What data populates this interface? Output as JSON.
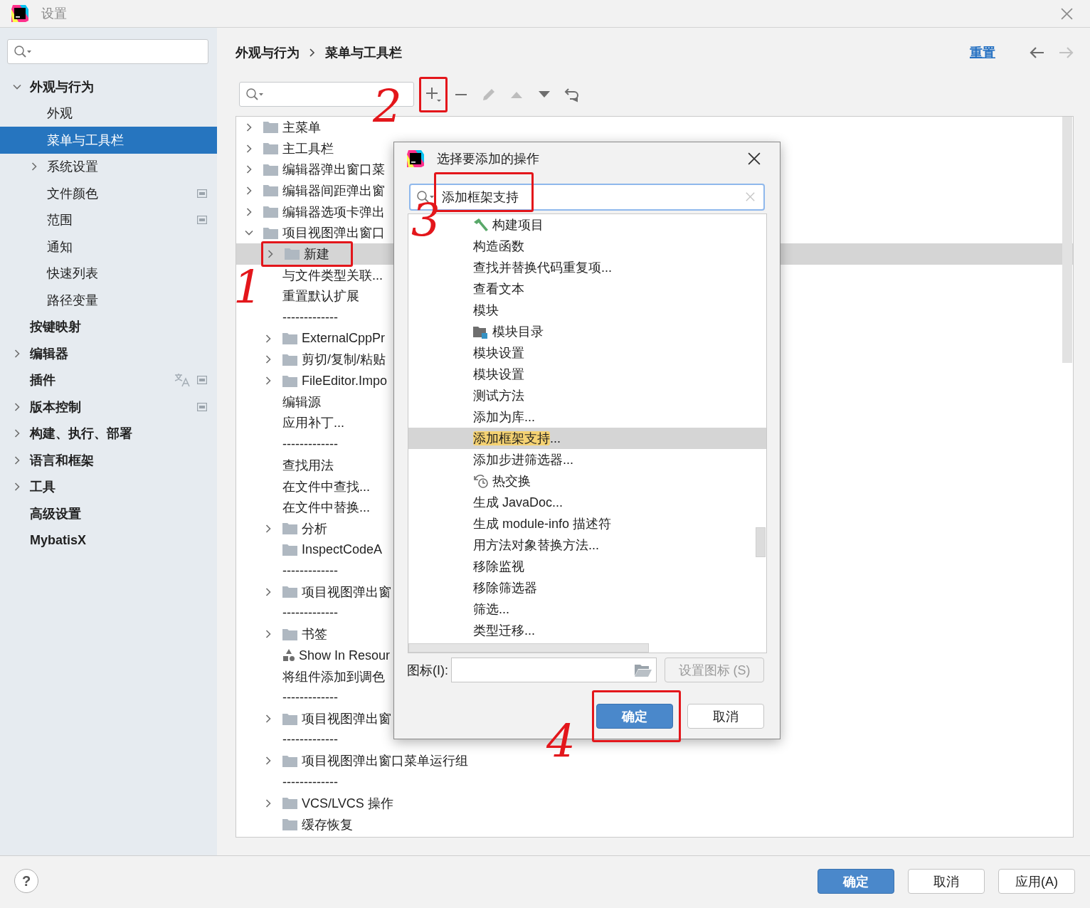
{
  "window": {
    "title": "设置"
  },
  "sidebar": {
    "items": [
      {
        "label": "外观与行为",
        "expanded": true,
        "selected": false,
        "project_scope": false,
        "translatable": false,
        "children": [
          {
            "label": "外观",
            "selected": false,
            "project_scope": false,
            "translatable": false
          },
          {
            "label": "菜单与工具栏",
            "selected": true,
            "project_scope": false,
            "translatable": false
          },
          {
            "label": "系统设置",
            "expanded": false,
            "selected": false,
            "project_scope": false,
            "translatable": false
          },
          {
            "label": "文件颜色",
            "selected": false,
            "project_scope": true,
            "translatable": false
          },
          {
            "label": "范围",
            "selected": false,
            "project_scope": true,
            "translatable": false
          },
          {
            "label": "通知",
            "selected": false,
            "project_scope": false,
            "translatable": false
          },
          {
            "label": "快速列表",
            "selected": false,
            "project_scope": false,
            "translatable": false
          },
          {
            "label": "路径变量",
            "selected": false,
            "project_scope": false,
            "translatable": false
          }
        ]
      },
      {
        "label": "按键映射",
        "selected": false,
        "project_scope": false,
        "translatable": false
      },
      {
        "label": "编辑器",
        "expanded": false,
        "selected": false,
        "project_scope": false,
        "translatable": false
      },
      {
        "label": "插件",
        "selected": false,
        "project_scope": true,
        "translatable": true
      },
      {
        "label": "版本控制",
        "expanded": false,
        "selected": false,
        "project_scope": true,
        "translatable": false
      },
      {
        "label": "构建、执行、部署",
        "expanded": false,
        "selected": false,
        "project_scope": false,
        "translatable": false
      },
      {
        "label": "语言和框架",
        "expanded": false,
        "selected": false,
        "project_scope": false,
        "translatable": false
      },
      {
        "label": "工具",
        "expanded": false,
        "selected": false,
        "project_scope": false,
        "translatable": false
      },
      {
        "label": "高级设置",
        "selected": false,
        "project_scope": false,
        "translatable": false
      },
      {
        "label": "MybatisX",
        "selected": false,
        "project_scope": false,
        "translatable": false
      }
    ]
  },
  "breadcrumb": [
    "外观与行为",
    "菜单与工具栏"
  ],
  "reset_link": "重置",
  "nav": [
    {
      "kind": "back",
      "disabled": false
    },
    {
      "kind": "forward",
      "disabled": true
    }
  ],
  "toolbar": {
    "buttons": [
      {
        "kind": "add",
        "disabled": false,
        "annotated": true
      },
      {
        "kind": "remove",
        "disabled": false,
        "annotated": false
      },
      {
        "kind": "edit",
        "disabled": true,
        "annotated": false
      },
      {
        "kind": "move-up",
        "disabled": true,
        "annotated": false
      },
      {
        "kind": "move-down",
        "disabled": false,
        "annotated": false
      },
      {
        "kind": "restore",
        "disabled": false,
        "annotated": false
      }
    ]
  },
  "action_tree": {
    "items": [
      {
        "kind": "folder",
        "label": "主菜单",
        "expanded": false,
        "selected": false,
        "annotated": false
      },
      {
        "kind": "folder",
        "label": "主工具栏",
        "expanded": false,
        "selected": false,
        "annotated": false
      },
      {
        "kind": "folder",
        "label": "编辑器弹出窗口菜",
        "expanded": false,
        "selected": false,
        "annotated": false
      },
      {
        "kind": "folder",
        "label": "编辑器间距弹出窗",
        "expanded": false,
        "selected": false,
        "annotated": false
      },
      {
        "kind": "folder",
        "label": "编辑器选项卡弹出",
        "expanded": false,
        "selected": false,
        "annotated": false
      },
      {
        "kind": "folder",
        "label": "项目视图弹出窗口",
        "expanded": true,
        "selected": false,
        "annotated": false,
        "children": [
          {
            "kind": "folder",
            "label": "新建",
            "expanded": false,
            "selected": true,
            "annotated": true
          },
          {
            "kind": "action",
            "label": "与文件类型关联...",
            "selected": false,
            "annotated": false
          },
          {
            "kind": "action",
            "label": "重置默认扩展",
            "selected": false,
            "annotated": false
          },
          {
            "kind": "separator",
            "label": "-------------",
            "selected": false,
            "annotated": false
          },
          {
            "kind": "folder",
            "label": "ExternalCppPr",
            "expanded": false,
            "selected": false,
            "annotated": false
          },
          {
            "kind": "folder",
            "label": "剪切/复制/粘贴",
            "expanded": false,
            "selected": false,
            "annotated": false
          },
          {
            "kind": "folder",
            "label": "FileEditor.Impo",
            "expanded": false,
            "selected": false,
            "annotated": false
          },
          {
            "kind": "action",
            "label": "编辑源",
            "selected": false,
            "annotated": false
          },
          {
            "kind": "action",
            "label": "应用补丁...",
            "selected": false,
            "annotated": false
          },
          {
            "kind": "separator",
            "label": "-------------",
            "selected": false,
            "annotated": false
          },
          {
            "kind": "action",
            "label": "查找用法",
            "selected": false,
            "annotated": false
          },
          {
            "kind": "action",
            "label": "在文件中查找...",
            "selected": false,
            "annotated": false
          },
          {
            "kind": "action",
            "label": "在文件中替换...",
            "selected": false,
            "annotated": false
          },
          {
            "kind": "folder",
            "label": "分析",
            "expanded": false,
            "selected": false,
            "annotated": false
          },
          {
            "kind": "folder",
            "label": "InspectCodeA",
            "selected": false,
            "annotated": false
          },
          {
            "kind": "separator",
            "label": "-------------",
            "selected": false,
            "annotated": false
          },
          {
            "kind": "folder",
            "label": "项目视图弹出窗",
            "expanded": false,
            "selected": false,
            "annotated": false
          },
          {
            "kind": "separator",
            "label": "-------------",
            "selected": false,
            "annotated": false
          },
          {
            "kind": "folder",
            "label": "书签",
            "expanded": false,
            "selected": false,
            "annotated": false
          },
          {
            "kind": "resource",
            "label": "Show In Resour",
            "selected": false,
            "annotated": false
          },
          {
            "kind": "action",
            "label": "将组件添加到调色",
            "selected": false,
            "annotated": false
          },
          {
            "kind": "separator",
            "label": "-------------",
            "selected": false,
            "annotated": false
          },
          {
            "kind": "folder",
            "label": "项目视图弹出窗",
            "expanded": false,
            "selected": false,
            "annotated": false
          },
          {
            "kind": "separator",
            "label": "-------------",
            "selected": false,
            "annotated": false
          },
          {
            "kind": "folder",
            "label": "项目视图弹出窗口菜单运行组",
            "expanded": false,
            "selected": false,
            "annotated": false
          },
          {
            "kind": "separator",
            "label": "-------------",
            "selected": false,
            "annotated": false
          },
          {
            "kind": "folder",
            "label": "VCS/LVCS 操作",
            "expanded": false,
            "selected": false,
            "annotated": false
          },
          {
            "kind": "folder",
            "label": "缓存恢复",
            "selected": false,
            "annotated": false
          }
        ]
      }
    ]
  },
  "dialog": {
    "title": "选择要添加的操作",
    "search": {
      "value": "添加框架支持",
      "annotated": true
    },
    "items": [
      {
        "kind": "hammer",
        "label": "构建项目",
        "selected": false
      },
      {
        "kind": "text",
        "label": "构造函数",
        "selected": false
      },
      {
        "kind": "text",
        "label": "查找并替换代码重复项...",
        "selected": false
      },
      {
        "kind": "text",
        "label": "查看文本",
        "selected": false
      },
      {
        "kind": "text",
        "label": "模块",
        "selected": false
      },
      {
        "kind": "module-folder",
        "label": "模块目录",
        "selected": false
      },
      {
        "kind": "text",
        "label": "模块设置",
        "selected": false
      },
      {
        "kind": "text",
        "label": "模块设置",
        "selected": false
      },
      {
        "kind": "text",
        "label": "测试方法",
        "selected": false
      },
      {
        "kind": "text",
        "label": "添加为库...",
        "selected": false
      },
      {
        "kind": "text",
        "match": "添加框架支持",
        "label": "...",
        "selected": true
      },
      {
        "kind": "text",
        "label": "添加步进筛选器...",
        "selected": false
      },
      {
        "kind": "hotswap",
        "label": "热交换",
        "selected": false
      },
      {
        "kind": "text",
        "label": "生成 JavaDoc...",
        "selected": false
      },
      {
        "kind": "text",
        "label": "生成 module-info 描述符",
        "selected": false
      },
      {
        "kind": "text",
        "label": "用方法对象替换方法...",
        "selected": false
      },
      {
        "kind": "text",
        "label": "移除监视",
        "selected": false
      },
      {
        "kind": "text",
        "label": "移除筛选器",
        "selected": false
      },
      {
        "kind": "text",
        "label": "筛选...",
        "selected": false
      },
      {
        "kind": "text",
        "label": "类型迁移...",
        "selected": false
      }
    ],
    "icon_field": {
      "label": "图标(I):"
    },
    "set_icon_button": {
      "label": "设置图标 (S)",
      "disabled": true
    },
    "buttons": [
      {
        "label": "确定",
        "kind": "primary",
        "annotated": true
      },
      {
        "label": "取消",
        "kind": "secondary",
        "annotated": false
      }
    ]
  },
  "footer": {
    "help": "?",
    "buttons": [
      {
        "label": "确定",
        "kind": "primary"
      },
      {
        "label": "取消",
        "kind": "secondary"
      },
      {
        "label": "应用(A)",
        "kind": "secondary"
      }
    ]
  },
  "annotations": [
    "1",
    "2",
    "3",
    "4"
  ]
}
